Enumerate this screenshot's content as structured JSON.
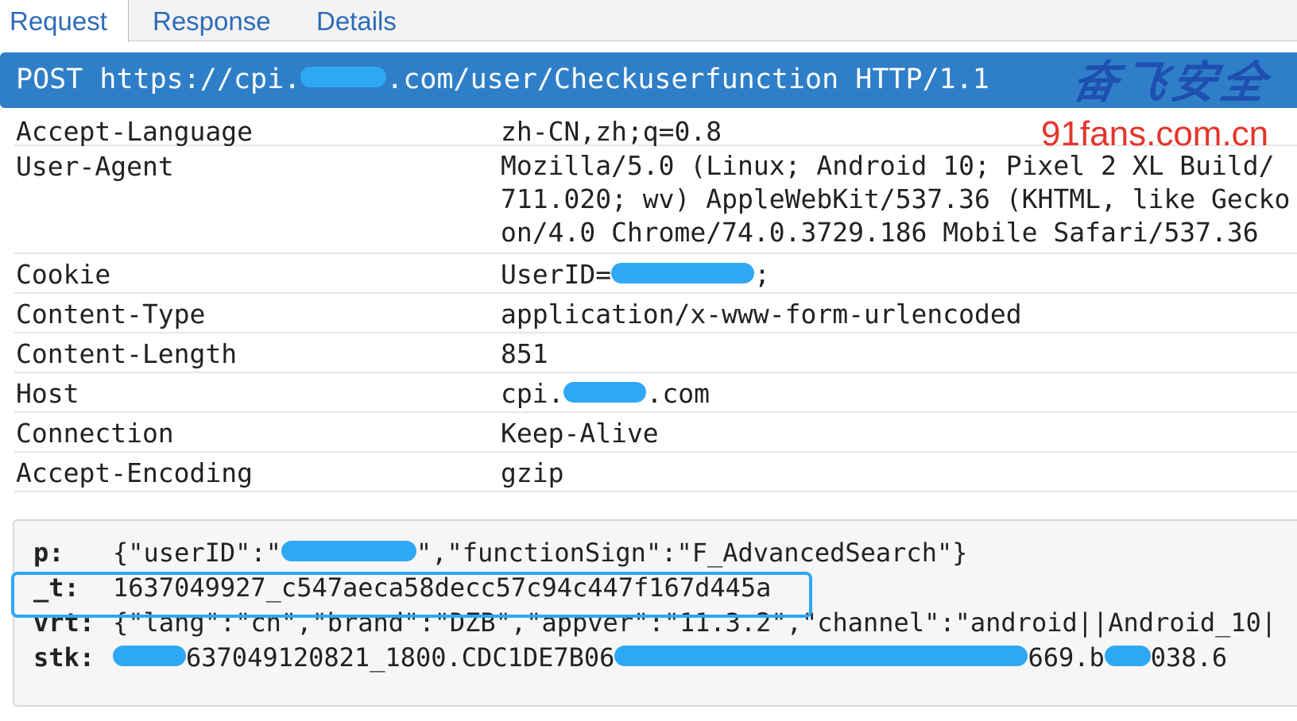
{
  "tabs": [
    {
      "label": "Request",
      "active": true
    },
    {
      "label": "Response",
      "active": false
    },
    {
      "label": "Details",
      "active": false
    }
  ],
  "request_line": {
    "method": "POST",
    "url_prefix": "https://cpi.",
    "url_suffix": ".com/user/Checkuserfunction",
    "protocol": "HTTP/1.1"
  },
  "watermark": {
    "chinese": "奋飞安全",
    "url": "91fans.com.cn"
  },
  "headers": [
    {
      "name": "Accept-Language",
      "value": "zh-CN,zh;q=0.8"
    },
    {
      "name": "User-Agent",
      "value": "Mozilla/5.0 (Linux; Android 10; Pixel 2 XL Build/\n711.020; wv) AppleWebKit/537.36 (KHTML, like Gecko\non/4.0 Chrome/74.0.3729.186 Mobile Safari/537.36"
    },
    {
      "name": "Cookie",
      "value_prefix": "UserID=",
      "value_suffix": ";"
    },
    {
      "name": "Content-Type",
      "value": "application/x-www-form-urlencoded"
    },
    {
      "name": "Content-Length",
      "value": "851"
    },
    {
      "name": "Host",
      "value_prefix": "cpi.",
      "value_suffix": ".com"
    },
    {
      "name": "Connection",
      "value": "Keep-Alive"
    },
    {
      "name": "Accept-Encoding",
      "value": "gzip"
    }
  ],
  "body": {
    "p": {
      "key": "p:",
      "value_prefix": "{\"userID\":\"",
      "value_suffix": "\",\"functionSign\":\"F_AdvancedSearch\"}"
    },
    "t": {
      "key": "_t:",
      "value": "1637049927_c547aeca58decc57c94c447f167d445a"
    },
    "vrt": {
      "key": "vrt:",
      "value": "{\"lang\":\"cn\",\"brand\":\"DZB\",\"appver\":\"11.3.2\",\"channel\":\"android||Android_10|"
    },
    "stk": {
      "key": "stk:",
      "value_a": "637049120821_1800.CDC1DE7B06",
      "value_b": "669.b",
      "value_c": "038.6"
    }
  },
  "colors": {
    "accent": "#2f7fc8",
    "tab_text": "#2c6bb8",
    "redaction": "#2ea8f5",
    "watermark_cn": "#1f4fb0",
    "watermark_url": "#e6342a"
  }
}
